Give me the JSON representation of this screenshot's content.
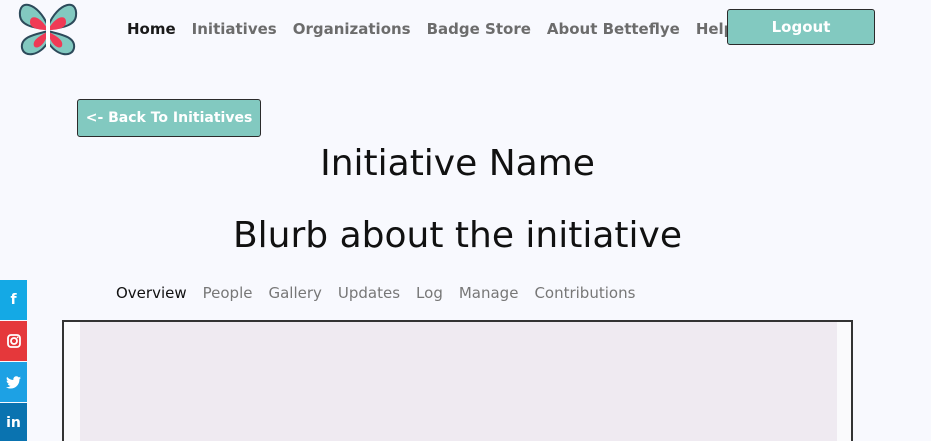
{
  "brand": {
    "accent": "#82c9c0",
    "logo_primary": "#82c9c0",
    "logo_secondary": "#f03a55"
  },
  "nav": {
    "items": [
      {
        "label": "Home",
        "active": true
      },
      {
        "label": "Initiatives",
        "active": false
      },
      {
        "label": "Organizations",
        "active": false
      },
      {
        "label": "Badge Store",
        "active": false
      },
      {
        "label": "About Betteflye",
        "active": false
      },
      {
        "label": "Help",
        "active": false
      }
    ],
    "logout_label": "Logout"
  },
  "back_button_label": "<- Back To Initiatives",
  "initiative": {
    "title": "Initiative Name",
    "blurb": "Blurb about the initiative"
  },
  "tabs": [
    {
      "label": "Overview",
      "active": true
    },
    {
      "label": "People",
      "active": false
    },
    {
      "label": "Gallery",
      "active": false
    },
    {
      "label": "Updates",
      "active": false
    },
    {
      "label": "Log",
      "active": false
    },
    {
      "label": "Manage",
      "active": false
    },
    {
      "label": "Contributions",
      "active": false
    }
  ],
  "social": [
    {
      "icon": "facebook-icon",
      "glyph": "f",
      "color": "#14a9e5"
    },
    {
      "icon": "instagram-icon",
      "glyph": "◎",
      "color": "#e5383b"
    },
    {
      "icon": "twitter-icon",
      "glyph": "🐦",
      "color": "#1da1e4"
    },
    {
      "icon": "linkedin-icon",
      "glyph": "in",
      "color": "#0a73b0"
    }
  ]
}
